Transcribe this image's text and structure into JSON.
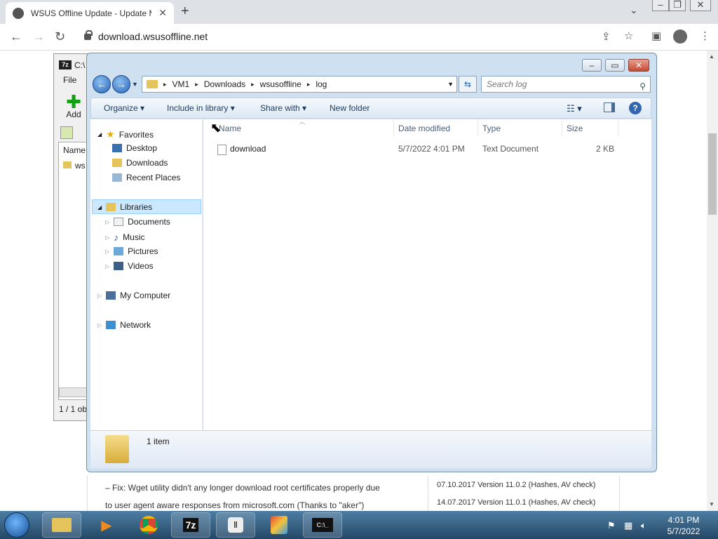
{
  "browser": {
    "tab_title": "WSUS Offline Update - Update M",
    "url": "download.wsusoffline.net",
    "new_tab": "+",
    "tab_close": "✕"
  },
  "page": {
    "text_line1": "– Fix: Wget utility didn't any longer download root certificates properly due",
    "text_line2": "to user agent aware responses from microsoft.com (Thanks to \"aker\")",
    "right_line1": "07.10.2017 Version 11.0.2 (Hashes, AV check)",
    "right_line2": "14.07.2017 Version 11.0.1 (Hashes, AV check)"
  },
  "sevenzip": {
    "title": "C:\\",
    "icon_label": "7z",
    "menu_file": "File",
    "add_label": "Add",
    "column_name": "Name",
    "item": "ws",
    "status": "1 / 1 ob"
  },
  "explorer": {
    "breadcrumb": [
      "VM1",
      "Downloads",
      "wsusoffline",
      "log"
    ],
    "search_placeholder": "Search log",
    "commands": {
      "organize": "Organize",
      "include_in_library": "Include in library",
      "share_with": "Share with",
      "new_folder": "New folder"
    },
    "nav": {
      "favorites": "Favorites",
      "desktop": "Desktop",
      "downloads": "Downloads",
      "recent_places": "Recent Places",
      "libraries": "Libraries",
      "documents": "Documents",
      "music": "Music",
      "pictures": "Pictures",
      "videos": "Videos",
      "my_computer": "My Computer",
      "network": "Network"
    },
    "columns": {
      "name": "Name",
      "date_modified": "Date modified",
      "type": "Type",
      "size": "Size"
    },
    "files": [
      {
        "name": "download",
        "date_modified": "5/7/2022 4:01 PM",
        "type": "Text Document",
        "size": "2 KB"
      }
    ],
    "status": "1 item"
  },
  "taskbar": {
    "time": "4:01 PM",
    "date": "5/7/2022",
    "sevenzip_label": "7z"
  }
}
